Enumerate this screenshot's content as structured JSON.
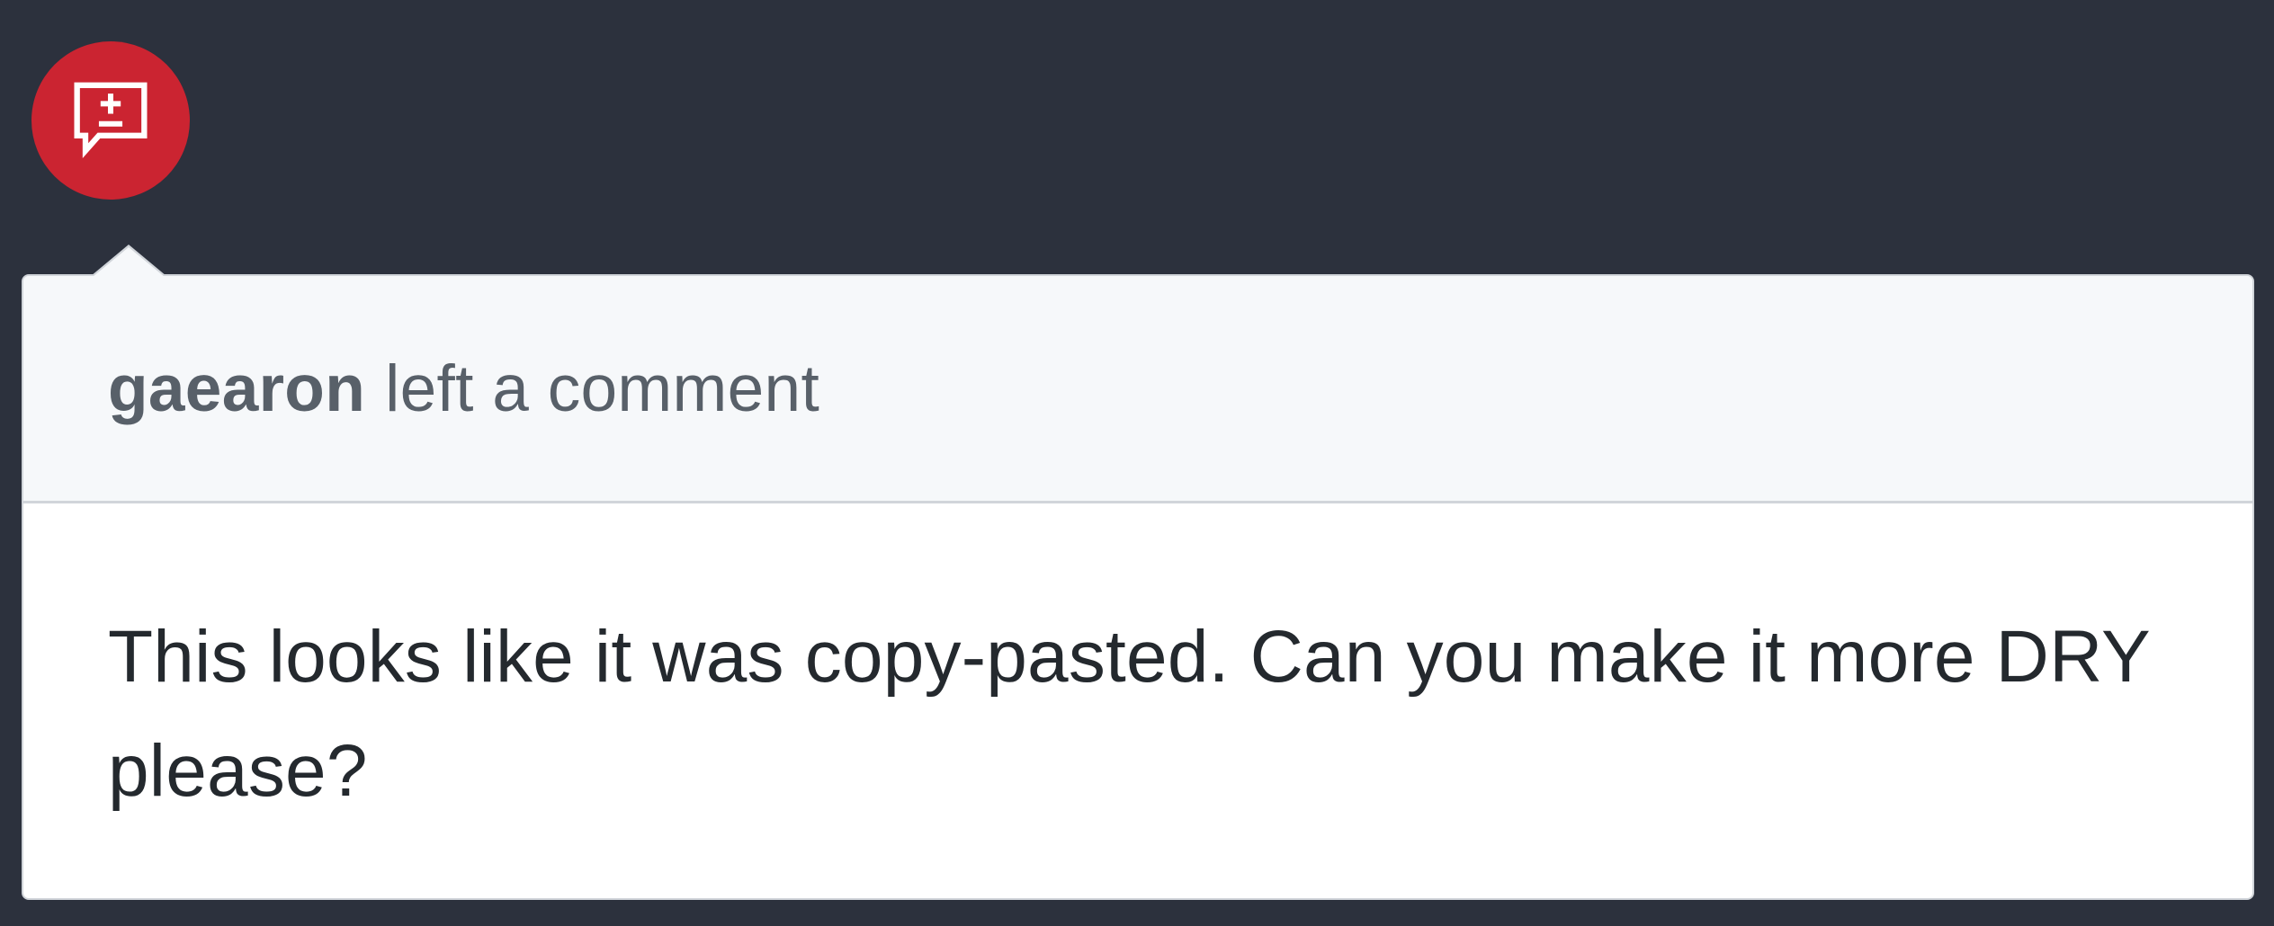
{
  "badge": {
    "icon": "diff-comment-icon",
    "color": "#cb2431"
  },
  "comment": {
    "author": "gaearon",
    "action": "left a comment",
    "body": "This looks like it was copy-pasted. Can you make it more DRY please?"
  },
  "colors": {
    "background": "#2c313d",
    "header_background": "#f6f8fa",
    "border": "#d1d5da",
    "header_text": "#586069",
    "body_text": "#24292e"
  }
}
